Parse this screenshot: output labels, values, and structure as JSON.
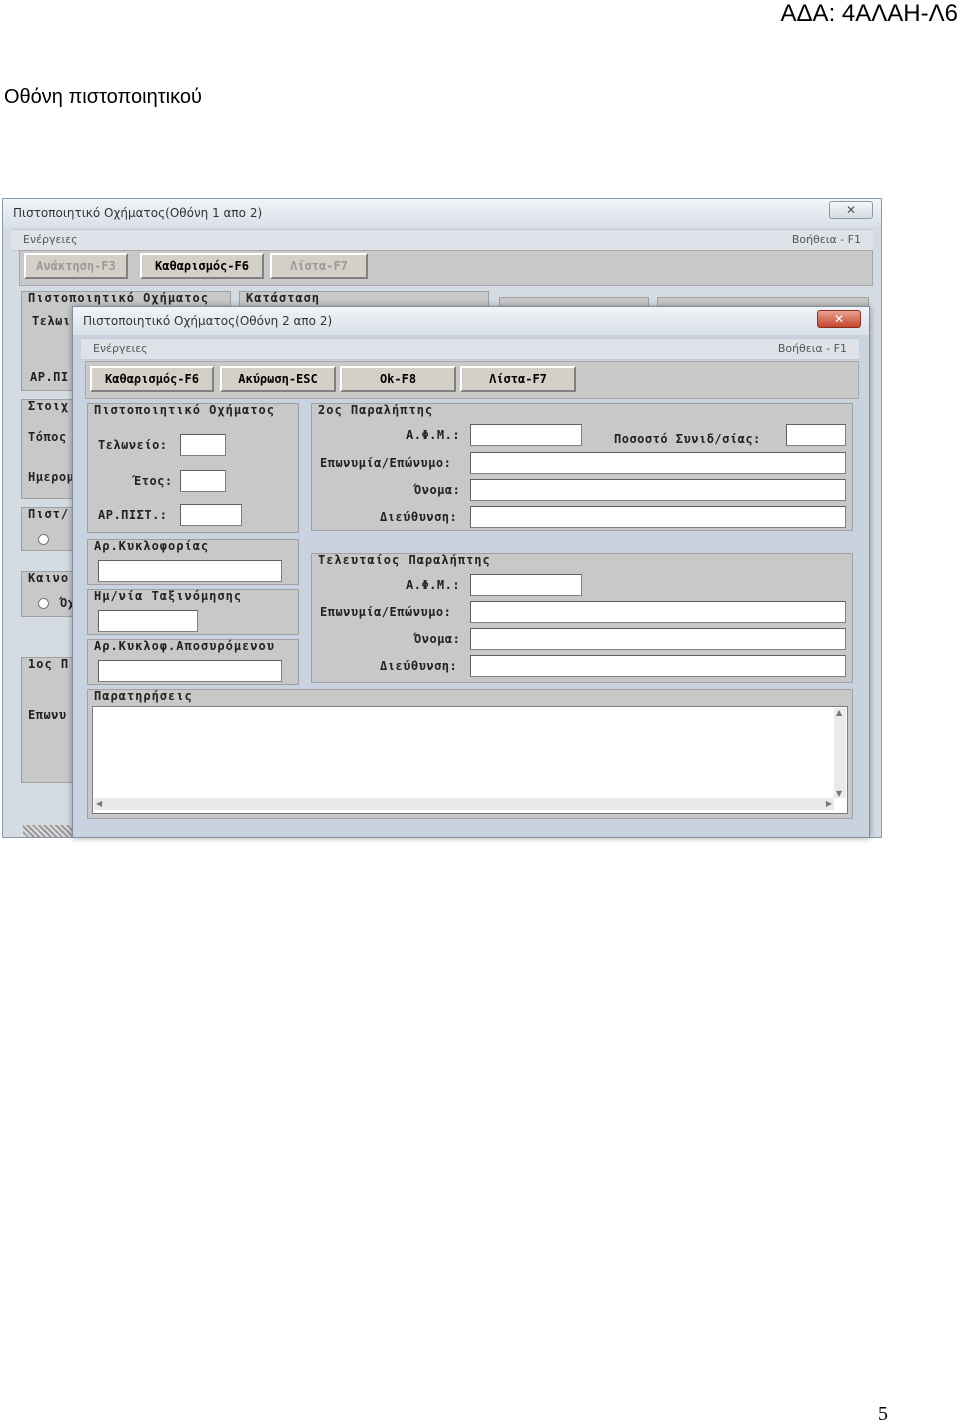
{
  "ada_label": "ΑΔΑ: 4ΑΛΑΗ-Λ6",
  "caption": "Οθόνη πιστοποιητικού",
  "page_number": "5",
  "back_window": {
    "title": "Πιστοποιητικό Οχήματος(Οθόνη 1 απο 2)",
    "close_icon": "close-icon",
    "menu_left": "Ενέργειες",
    "menu_right": "Βοήθεια - F1",
    "buttons": [
      "Ανάκτηση-F3",
      "Καθαρισμός-F6",
      "Λίστα-F7"
    ],
    "group_certificate": "Πιστοποιητικό Οχήματος",
    "group_status": "Κατάσταση",
    "label_customs": "Τελωι",
    "label_cert_no": "ΑΡ.ΠΙ",
    "group_stoix": "Στοιχ",
    "label_place": "Τόπος",
    "label_date": "Ημερομ",
    "group_pist": "Πιστ/",
    "group_kainou": "Καινο",
    "radio_label": "Όχ",
    "group_first": "1ος Π",
    "label_surname": "Επωνυ"
  },
  "front_window": {
    "title": "Πιστοποιητικό Οχήματος(Οθόνη 2 απο 2)",
    "close_icon": "close-icon",
    "menu_left": "Ενέργειες",
    "menu_right": "Βοήθεια - F1",
    "buttons": [
      "Καθαρισμός-F6",
      "Ακύρωση-ESC",
      "Ok-F8",
      "Λίστα-F7"
    ],
    "cert_group": {
      "title": "Πιστοποιητικό Οχήματος",
      "customs_label": "Τελωνείο:",
      "customs_value": "",
      "year_label": "Έτος:",
      "year_value": "",
      "certno_label": "ΑΡ.ΠΙΣΤ.:",
      "certno_value": ""
    },
    "plate_group": {
      "title": "Αρ.Κυκλοφορίας",
      "value": ""
    },
    "classdate_group": {
      "title": "Ημ/νία Ταξινόμησης",
      "value": ""
    },
    "towed_group": {
      "title": "Αρ.Κυκλοφ.Αποσυρόμενου",
      "value": ""
    },
    "second_recipient": {
      "title": "2ος Παραλήπτης",
      "afm_label": "Α.Φ.Μ.:",
      "afm_value": "",
      "share_label": "Ποσοστό Συνιδ/σίας:",
      "share_value": "",
      "surname_label": "Επωνυμία/Επώνυμο:",
      "surname_value": "",
      "name_label": "Όνομα:",
      "name_value": "",
      "address_label": "Διεύθυνση:",
      "address_value": ""
    },
    "last_recipient": {
      "title": "Τελευταίος Παραλήπτης",
      "afm_label": "Α.Φ.Μ.:",
      "afm_value": "",
      "surname_label": "Επωνυμία/Επώνυμο:",
      "surname_value": "",
      "name_label": "Όνομα:",
      "name_value": "",
      "address_label": "Διεύθυνση:",
      "address_value": ""
    },
    "remarks": {
      "title": "Παρατηρήσεις",
      "value": ""
    }
  }
}
